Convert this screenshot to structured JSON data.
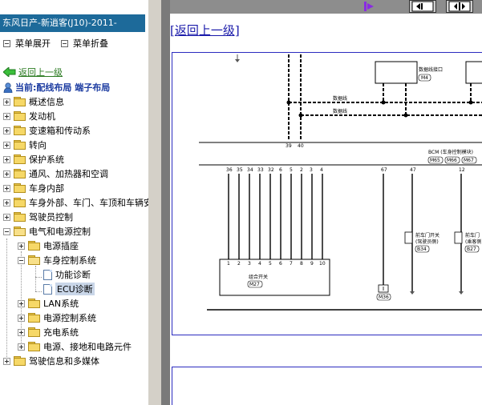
{
  "sidebar": {
    "title": "东风日产-新逍客(J10)-2011-",
    "menu_expand": "菜单展开",
    "menu_collapse": "菜单折叠",
    "back": "返回上一级",
    "current": "当前:配线布局 端子布局",
    "tree": [
      {
        "label": "概述信息"
      },
      {
        "label": "发动机"
      },
      {
        "label": "变速箱和传动系"
      },
      {
        "label": "转向"
      },
      {
        "label": "保护系统"
      },
      {
        "label": "通风、加热器和空调"
      },
      {
        "label": "车身内部"
      },
      {
        "label": "车身外部、车门、车顶和车辆安"
      },
      {
        "label": "驾驶员控制"
      },
      {
        "label": "电气和电源控制"
      },
      {
        "label": "电源插座"
      },
      {
        "label": "车身控制系统"
      },
      {
        "label": "功能诊断"
      },
      {
        "label": "ECU诊断"
      },
      {
        "label": "LAN系统"
      },
      {
        "label": "电源控制系统"
      },
      {
        "label": "充电系统"
      },
      {
        "label": "电源、接地和电路元件"
      },
      {
        "label": "驾驶信息和多媒体"
      }
    ]
  },
  "main": {
    "back_link": "[返回上一级]"
  },
  "diagram": {
    "data_link": "数据线接口",
    "data_link_code": "M4",
    "data_line_1": "数据线",
    "data_line_2": "数据线",
    "bcm": "BCM (车身控制模块)",
    "bcm_codes": [
      "M65",
      "M66",
      "M67"
    ],
    "combo_switch": "组合开关",
    "combo_code": "M27",
    "door_sw_front_driver": "前车门开关",
    "door_sw_front_driver_sub": "(驾驶员侧)",
    "door_sw_front_driver_code": "B34",
    "door_sw_front_pass": "前车门",
    "door_sw_front_pass_sub": "(乘客侧",
    "door_sw_front_pass_code": "B27",
    "ground_code": "M36",
    "pins_top_a": [
      "39",
      "40"
    ],
    "pins_top_b": [
      "36",
      "35",
      "34",
      "33",
      "32",
      "6",
      "5",
      "2",
      "3",
      "4",
      "67",
      "47",
      "12"
    ],
    "pins_combo": [
      "1",
      "2",
      "3",
      "4",
      "5",
      "6",
      "7",
      "8",
      "9",
      "10"
    ]
  }
}
